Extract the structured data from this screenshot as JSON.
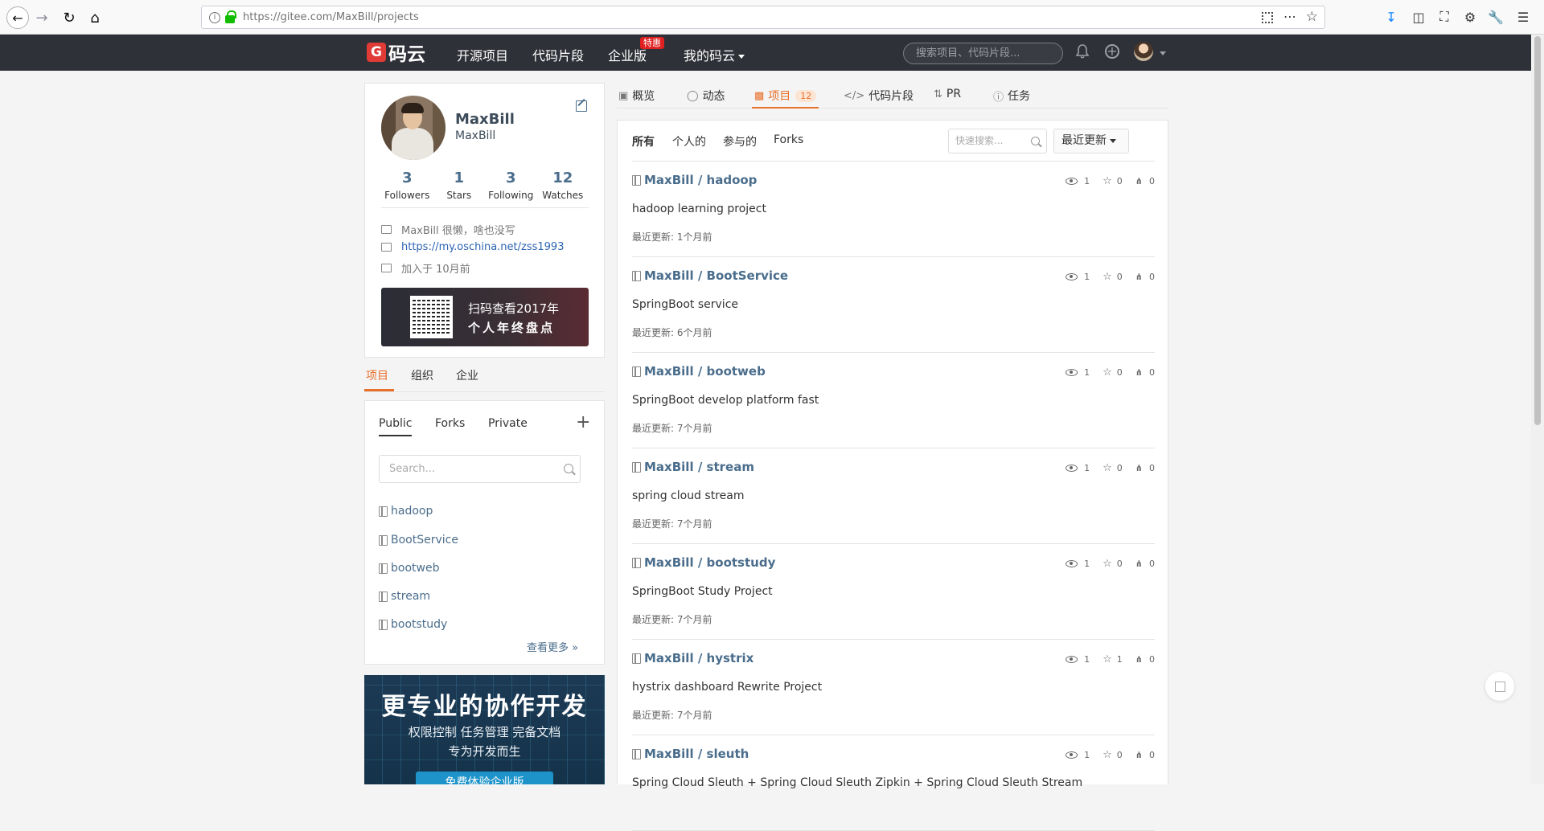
{
  "browser": {
    "url": "https://gitee.com/MaxBill/projects"
  },
  "header": {
    "logo_text": "码云",
    "nav": [
      "开源项目",
      "代码片段",
      "企业版",
      "我的码云"
    ],
    "enterprise_badge": "特惠",
    "search_placeholder": "搜索项目、代码片段...",
    "accent_color": "#e03b36"
  },
  "profile": {
    "name": "MaxBill",
    "login": "MaxBill",
    "stats": [
      {
        "num": "3",
        "label": "Followers"
      },
      {
        "num": "1",
        "label": "Stars"
      },
      {
        "num": "3",
        "label": "Following"
      },
      {
        "num": "12",
        "label": "Watches"
      }
    ],
    "bio": "MaxBill 很懒，啥也没写",
    "website": "https://my.oschina.net/zss1993",
    "joined": "加入于 10月前",
    "promo_line1": "扫码查看2017年",
    "promo_line2": "个人年终盘点"
  },
  "left_tabs": [
    "项目",
    "组织",
    "企业"
  ],
  "repo_panel": {
    "vis_tabs": [
      "Public",
      "Forks",
      "Private"
    ],
    "search_placeholder": "Search...",
    "repos": [
      "hadoop",
      "BootService",
      "bootweb",
      "stream",
      "bootstudy"
    ],
    "see_more": "查看更多 »"
  },
  "enterprise_banner": {
    "title": "更专业的协作开发",
    "line1": "权限控制   任务管理   完备文档",
    "line2": "专为开发而生",
    "button": "免费体验企业版"
  },
  "main_tabs": {
    "items": [
      "概览",
      "动态",
      "项目",
      "代码片段",
      "PR",
      "任务"
    ],
    "project_count": "12",
    "accent_color": "#e8702a"
  },
  "filters": {
    "items": [
      "所有",
      "个人的",
      "参与的",
      "Forks"
    ],
    "search_placeholder": "快速搜索...",
    "sort_label": "最近更新"
  },
  "projects": [
    {
      "owner": "MaxBill",
      "name": "hadoop",
      "desc": "hadoop learning project",
      "updated": "最近更新: 1个月前",
      "watch": "1",
      "star": "0",
      "fork": "0"
    },
    {
      "owner": "MaxBill",
      "name": "BootService",
      "desc": "SpringBoot service",
      "updated": "最近更新: 6个月前",
      "watch": "1",
      "star": "0",
      "fork": "0"
    },
    {
      "owner": "MaxBill",
      "name": "bootweb",
      "desc": "SpringBoot develop platform fast",
      "updated": "最近更新: 7个月前",
      "watch": "1",
      "star": "0",
      "fork": "0"
    },
    {
      "owner": "MaxBill",
      "name": "stream",
      "desc": "spring cloud stream",
      "updated": "最近更新: 7个月前",
      "watch": "1",
      "star": "0",
      "fork": "0"
    },
    {
      "owner": "MaxBill",
      "name": "bootstudy",
      "desc": "SpringBoot Study Project",
      "updated": "最近更新: 7个月前",
      "watch": "1",
      "star": "0",
      "fork": "0"
    },
    {
      "owner": "MaxBill",
      "name": "hystrix",
      "desc": "hystrix dashboard Rewrite Project",
      "updated": "最近更新: 7个月前",
      "watch": "1",
      "star": "1",
      "fork": "0"
    },
    {
      "owner": "MaxBill",
      "name": "sleuth",
      "desc": "Spring Cloud Sleuth + Spring Cloud Sleuth Zipkin + Spring Cloud Sleuth Stream",
      "updated": "",
      "watch": "1",
      "star": "0",
      "fork": "0"
    }
  ]
}
